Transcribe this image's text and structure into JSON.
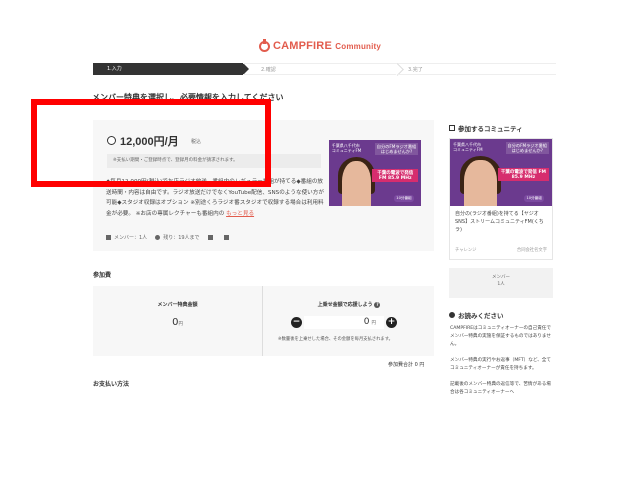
{
  "header": {
    "brand": "CAMPFIRE",
    "brand_sub": "Community"
  },
  "steps": [
    {
      "label": "1.入力"
    },
    {
      "label": "2.確認"
    },
    {
      "label": "3.完了"
    }
  ],
  "page_title": "メンバー特典を選択し、必要情報を入力してください",
  "plan": {
    "price": "12,000円/月",
    "tax": "税込",
    "notice": "※支払い期間・ご登録時点で、登録月の料金が請求されます。",
    "description": "◆毎月12,000円(税込)でお店ラジオ放送。番組内のレギュラー番組が持てる◆番組の放送時間・内容は自由です。ラジオ放送だけでなくYouTube配信、SNSのような使い方が可能◆スタジオ収録はオプション ※別途くろラジオ番スタジオで収録する場合は利用料金が必要。 ※お店の専属レクチャーも番組内の",
    "more_link": "もっと見る",
    "members": "メンバー：1人",
    "limit": "残り：19人まで",
    "thumb": {
      "left_text": "千葉県八千代市\nコミュニティFM",
      "right_text": "自分のFMラジオ番組\nはじめませんか?",
      "banner": "千葉の電波で発信 FM 85.9 MHz",
      "sub": "10分番組"
    }
  },
  "amount": {
    "section_label": "参加費",
    "member_label": "メンバー特典金額",
    "member_value": "0",
    "unit": "円",
    "support_label": "上乗せ金額で応援しよう",
    "support_value": "0",
    "minus": "−",
    "plus": "+",
    "note": "※数量後を上乗せした場合、その金額を毎月支払されます。"
  },
  "total": "参加費合計 0 円",
  "payment_label": "お支払い方法",
  "sidebar": {
    "community_title": "参加するコミュニティ",
    "card_title": "自分の(ラジオ番組)を持てる【ヤジオSNS】ストリームコミュニティFM(くちラ)",
    "card_category": "チャレンジ",
    "card_author": "合同会社名文字",
    "stat_label": "メンバー",
    "stat_value": "1人",
    "notes_title": "お読みください",
    "notes": [
      "CAMPFIREはコミュニティオーナーの自己責任でメンバー特典の実施を保証するものではありません。",
      "メンバー特典の実行やお返事（MFT）など、全てコミュニティオーナーが責任を持ちます。",
      "記載後のメンバー特典の返信等で、苦情がある場合は各コミュニティオーナーへ"
    ]
  }
}
